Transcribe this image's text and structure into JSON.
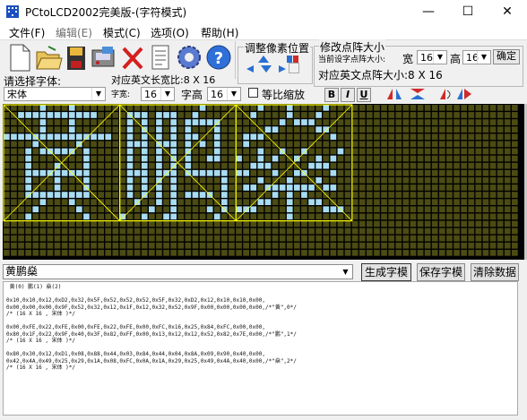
{
  "window": {
    "title": "PCtoLCD2002完美版-(字符模式)",
    "min_glyph": "—",
    "max_glyph": "☐",
    "close_glyph": "✕"
  },
  "menu": [
    "文件(F)",
    "编辑(E)",
    "模式(C)",
    "选项(O)",
    "帮助(H)"
  ],
  "toolbar": {
    "icons": [
      "new-file-icon",
      "open-folder-icon",
      "save-icon",
      "save-as-icon",
      "delete-icon",
      "notes-icon",
      "settings-icon",
      "help-icon"
    ]
  },
  "adjust_group": {
    "title": "调整像素位置"
  },
  "resize_group": {
    "title": "修改点阵大小",
    "current_label": "当前设字点阵大小:",
    "width_label": "宽",
    "width_value": "16",
    "height_label": "高",
    "height_value": "16",
    "confirm": "确定",
    "ascii_info": "对应英文点阵大小:8 X 16"
  },
  "font": {
    "label": "请选择字体:",
    "ascii_width_info": "对应英文长宽比:8 X 16",
    "value": "宋体",
    "char_width_label": "字宽:",
    "char_width": "16",
    "char_height_label": "字高",
    "char_height": "16",
    "scale_label": "等比缩放",
    "bold": "B",
    "italic": "I",
    "underline": "U"
  },
  "input": {
    "text": "黄鹏燊",
    "generate": "生成字模",
    "save": "保存字模",
    "clear": "清除数据"
  },
  "output_lines": [
    " 黄(0) 鹏(1) 燊(2)",
    "",
    "0x10,0x10,0x12,0xD2,0x32,0x5F,0x52,0x52,0x52,0x5F,0x32,0xD2,0x12,0x10,0x10,0x00,",
    "0x00,0x00,0x00,0x9F,0x52,0x32,0x12,0x1F,0x12,0x32,0x52,0x9F,0x00,0x00,0x00,0x00,/*\"黄\",0*/",
    "/* (16 X 16 , 宋体 )*/",
    "",
    "0x00,0xFE,0x22,0xFE,0x00,0xFE,0x22,0xFE,0x00,0xFC,0x16,0x25,0x84,0xFC,0x00,0x00,",
    "0x80,0x1F,0x22,0x9F,0x40,0x3F,0x82,0xFF,0x00,0x13,0x12,0x12,0x52,0x82,0x7E,0x00,/*\"鹏\",1*/",
    "/* (16 X 16 , 宋体 )*/",
    "",
    "0x80,0x30,0x12,0xD1,0x08,0x88,0x44,0x03,0x84,0x44,0x04,0x8A,0x09,0x90,0x40,0x00,",
    "0x42,0x4A,0x49,0x25,0x29,0x1A,0x08,0xFC,0x0A,0x1A,0x29,0x25,0x49,0x4A,0x40,0x00,/*\"燊\",2*/",
    "/* (16 X 16 , 宋体 )*/"
  ],
  "colors": {
    "grid_bg": "#000000",
    "pixel_off": "#4b4b14",
    "pixel_on": "#a8dcf2",
    "char_frame": "#ffff00"
  },
  "glyphs": [
    {
      "char": "黄",
      "columns": [
        "0x10",
        "0x10",
        "0x12",
        "0xD2",
        "0x32",
        "0x5F",
        "0x52",
        "0x52",
        "0x52",
        "0x5F",
        "0x32",
        "0xD2",
        "0x12",
        "0x10",
        "0x10",
        "0x00",
        "0x00",
        "0x00",
        "0x00",
        "0x9F",
        "0x52",
        "0x32",
        "0x12",
        "0x1F",
        "0x12",
        "0x32",
        "0x52",
        "0x9F",
        "0x00",
        "0x00",
        "0x00",
        "0x00"
      ]
    },
    {
      "char": "鹏",
      "columns": [
        "0x00",
        "0xFE",
        "0x22",
        "0xFE",
        "0x00",
        "0xFE",
        "0x22",
        "0xFE",
        "0x00",
        "0xFC",
        "0x16",
        "0x25",
        "0x84",
        "0xFC",
        "0x00",
        "0x00",
        "0x80",
        "0x1F",
        "0x22",
        "0x9F",
        "0x40",
        "0x3F",
        "0x82",
        "0xFF",
        "0x00",
        "0x13",
        "0x12",
        "0x12",
        "0x52",
        "0x82",
        "0x7E",
        "0x00"
      ]
    },
    {
      "char": "燊",
      "columns": [
        "0x80",
        "0x30",
        "0x12",
        "0xD1",
        "0x08",
        "0x88",
        "0x44",
        "0x03",
        "0x84",
        "0x44",
        "0x04",
        "0x8A",
        "0x09",
        "0x90",
        "0x40",
        "0x00",
        "0x42",
        "0x4A",
        "0x49",
        "0x25",
        "0x29",
        "0x1A",
        "0x08",
        "0xFC",
        "0x0A",
        "0x1A",
        "0x29",
        "0x25",
        "0x49",
        "0x4A",
        "0x40",
        "0x00"
      ]
    }
  ]
}
